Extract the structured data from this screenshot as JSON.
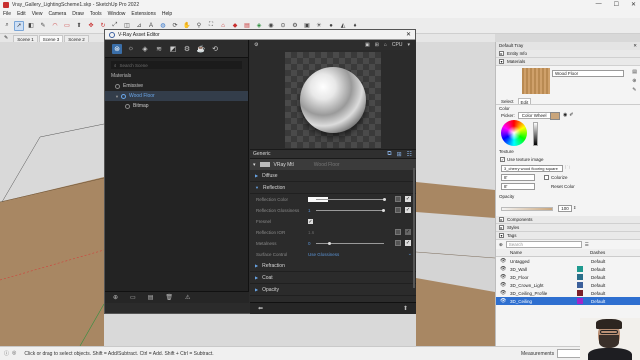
{
  "window": {
    "title": "Vray_Gallery_LightingScheme1.skp - SketchUp Pro 2022",
    "controls": [
      "—",
      "☐",
      "✕"
    ]
  },
  "menu": [
    "File",
    "Edit",
    "View",
    "Camera",
    "Draw",
    "Tools",
    "Window",
    "Extensions",
    "Help"
  ],
  "scenes": {
    "tabs": [
      "Scene 1",
      "Scene 3",
      "Scene 2"
    ],
    "active_index": 1
  },
  "vray": {
    "title": "V-Ray Asset Editor",
    "search_placeholder": "Search Scene",
    "materials_header": "Materials",
    "materials": [
      "Emissive",
      "Wood Floor"
    ],
    "sub_item": "Bitmap",
    "selected": "Wood Floor",
    "preview_controls": [
      "▣",
      "⊞",
      "⌂",
      "CPU",
      "▾"
    ],
    "generic_label": "Generic",
    "mtl_label": "VRay Mtl",
    "mtl_name_ghost": "Wood Floor",
    "sections": {
      "diffuse": "Diffuse",
      "reflection": "Reflection",
      "refraction": "Refraction",
      "coat": "Coat",
      "opacity": "Opacity"
    },
    "reflection_props": {
      "color_label": "Reflection Color",
      "glossiness_label": "Reflection Glossiness",
      "glossiness_value": "1",
      "fresnel_label": "Fresnel",
      "ior_label": "Reflection IOR",
      "ior_value": "1.6",
      "metalness_label": "Metalness",
      "metalness_value": "0",
      "surface_label": "Surface Control",
      "surface_value": "Use Glossiness"
    },
    "reflection_glossiness": 1.0,
    "metalness": 0.0
  },
  "tray": {
    "title": "Default Tray",
    "entity_info": "Entity Info",
    "materials": "Materials",
    "material_name": "Wood Floor",
    "tabs": [
      "Select",
      "Edit"
    ],
    "active_tab": "Edit",
    "color_label": "Color",
    "picker_label": "Picker:",
    "picker_value": "Color Wheel",
    "texture_label": "Texture",
    "use_texture": "Use texture image",
    "texture_file": "3_cherry wood flooring square",
    "dim_w": "8'",
    "dim_h": "8'",
    "colorize": "Colorize",
    "reset_color": "Reset Color",
    "opacity_label": "Opacity",
    "opacity_value": "100",
    "opacity_percent": 100,
    "components": "Components",
    "styles": "Styles",
    "tags": "Tags",
    "tags_search_placeholder": "Search",
    "tags_cols": {
      "name": "Name",
      "dashes": "Dashes"
    },
    "tag_rows": [
      {
        "name": "Untagged",
        "dashes": "Default",
        "color": "#f4f4f4"
      },
      {
        "name": "3D_Wall",
        "dashes": "Default",
        "color": "#1f9a8f"
      },
      {
        "name": "3D_Floor",
        "dashes": "Default",
        "color": "#2a6f8a"
      },
      {
        "name": "3D_Crown_Light",
        "dashes": "Default",
        "color": "#3b5f9b"
      },
      {
        "name": "3D_Ceiling_Profile",
        "dashes": "Default",
        "color": "#7a1f2a"
      },
      {
        "name": "3D_Ceiling",
        "dashes": "Default",
        "color": "#a225c9"
      }
    ],
    "selected_tag": "3D_Ceiling"
  },
  "status": {
    "message": "Click or drag to select objects. Shift = Add/Subtract. Ctrl = Add. Shift + Ctrl = Subtract.",
    "measurements": "Measurements"
  },
  "colors": {
    "vray_accent": "#5b94d6",
    "ground": "#a88763",
    "sky": "#d6d6d6"
  }
}
